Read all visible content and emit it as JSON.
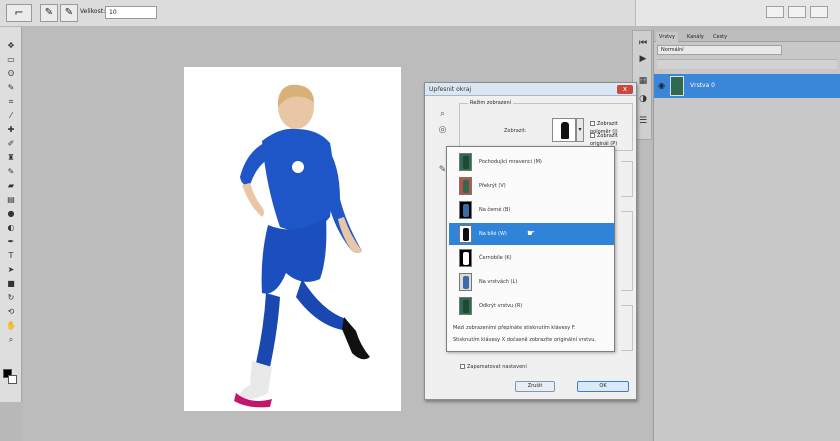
{
  "options_bar": {
    "tool_preset_icon": "quick-selection-brush",
    "option_label": "Velikost:",
    "option_value": "10"
  },
  "toolbox": {
    "tools": [
      "move-icon",
      "marquee-icon",
      "lasso-icon",
      "quick-select-icon",
      "crop-icon",
      "eyedropper-icon",
      "healing-icon",
      "brush-icon",
      "clone-stamp-icon",
      "history-brush-icon",
      "eraser-icon",
      "gradient-icon",
      "blur-icon",
      "dodge-icon",
      "pen-icon",
      "type-icon",
      "path-select-icon",
      "shape-icon",
      "3d-rotate-icon",
      "3d-camera-icon",
      "hand-icon",
      "zoom-icon"
    ],
    "foreground_color": "#000000",
    "background_color": "#ffffff"
  },
  "layers_panel": {
    "tabs": [
      "Vrstvy",
      "Kanály",
      "Cesty"
    ],
    "blend_mode": "Normální",
    "layer_name": "Vrstva 0",
    "accent": "#3a86d9"
  },
  "dialog": {
    "title": "Upřesnit okraj",
    "close_label": "x",
    "group_title": "Režim zobrazení",
    "view_label": "Zobrazit:",
    "checkbox_show_radius": "Zobrazit poloměr (J)",
    "checkbox_show_original": "Zobrazit originál (P)",
    "menu_items": [
      {
        "label": "Pochodující mravenci (M)",
        "thumb": "#2f6a50",
        "fig": "#1d4a35"
      },
      {
        "label": "Překrýt (V)",
        "thumb": "#b85444",
        "fig": "#2f6a50"
      },
      {
        "label": "Na černé (B)",
        "thumb": "#000000",
        "fig": "#3a6ca8"
      },
      {
        "label": "Na bílé (W)",
        "thumb": "#ffffff",
        "fig": "#111111"
      },
      {
        "label": "Černobíle (K)",
        "thumb": "#000000",
        "fig": "#ffffff"
      },
      {
        "label": "Na vrstvách (L)",
        "thumb": "#dcdcdc",
        "fig": "#3a6ca8"
      },
      {
        "label": "Odkrýt vrstvu (R)",
        "thumb": "#2f6a50",
        "fig": "#1d4a35"
      }
    ],
    "active_index": 3,
    "note_line1": "Mezi zobrazeními přepínáte stisknutím klávesy F.",
    "note_line2": "Stisknutím klávesy X dočasně zobrazíte originální vrstvu.",
    "remember_label": "Zapamatovat nastavení",
    "cancel_label": "Zrušit",
    "ok_label": "OK"
  }
}
